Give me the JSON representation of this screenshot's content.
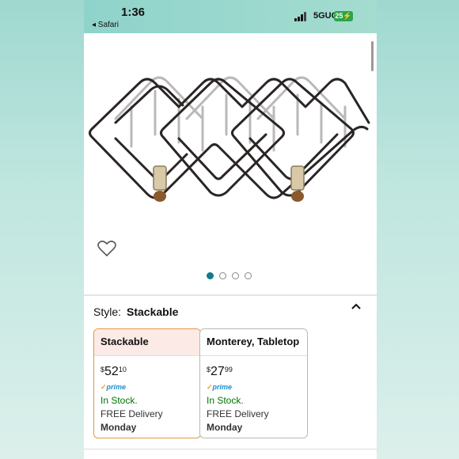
{
  "status_bar": {
    "time": "1:36",
    "back_label": "◂ Safari",
    "network": "5GUC",
    "battery": "25"
  },
  "product": {
    "image_alt": "stackable wine rack",
    "carousel": {
      "total": 4,
      "active": 1
    }
  },
  "variation": {
    "label": "Style:",
    "selected": "Stackable"
  },
  "options": [
    {
      "name": "Stackable",
      "price_symbol": "$",
      "price_whole": "52",
      "price_fraction": "10",
      "prime": "prime",
      "stock": "In Stock.",
      "delivery_prefix": "FREE Delivery",
      "delivery_day": "Monday",
      "selected": true
    },
    {
      "name": "Monterey, Tabletop",
      "price_symbol": "$",
      "price_whole": "27",
      "price_fraction": "99",
      "prime": "prime",
      "stock": "In Stock.",
      "delivery_prefix": "FREE Delivery",
      "delivery_day": "Monday",
      "selected": false
    }
  ],
  "colors": {
    "accent": "#0f7c8f",
    "selected_border": "#e09a40",
    "in_stock": "#007600",
    "prime": "#1d8fd1"
  },
  "icons": {
    "heart": "heart-icon",
    "collapse": "chevron-up-icon"
  }
}
